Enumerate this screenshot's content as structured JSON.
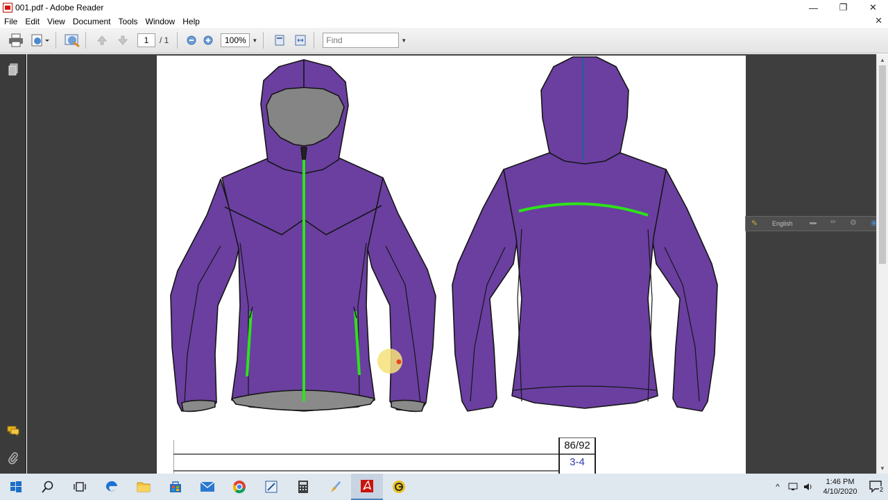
{
  "window": {
    "title": "001.pdf - Adobe Reader",
    "minimize_glyph": "—",
    "restore_glyph": "❐",
    "close_glyph": "✕"
  },
  "menu": {
    "items": [
      "File",
      "Edit",
      "View",
      "Document",
      "Tools",
      "Window",
      "Help"
    ],
    "doc_close_glyph": "✕"
  },
  "toolbar": {
    "page_current": "1",
    "page_total": "/ 1",
    "zoom": "100%",
    "find_placeholder": "Find",
    "icons": [
      "print-icon",
      "save-icon",
      "collaborate-icon",
      "previous-page-icon",
      "next-page-icon",
      "zoom-out-icon",
      "zoom-in-icon",
      "fit-page-icon",
      "fit-width-icon"
    ]
  },
  "document": {
    "garment_color": "#6a3fa0",
    "accent_color": "#2de31a",
    "size_table": {
      "size": "86/92",
      "age": "3-4"
    }
  },
  "langbar": {
    "language": "English"
  },
  "taskbar": {
    "apps": [
      "start-icon",
      "search-icon",
      "task-view-icon",
      "edge-icon",
      "file-explorer-icon",
      "store-icon",
      "mail-icon",
      "chrome-icon",
      "snipping-icon",
      "calculator-icon",
      "paint-icon",
      "adobe-reader-icon",
      "recorder-icon"
    ],
    "time": "1:46 PM",
    "date": "4/10/2020",
    "notification_count": "2"
  }
}
